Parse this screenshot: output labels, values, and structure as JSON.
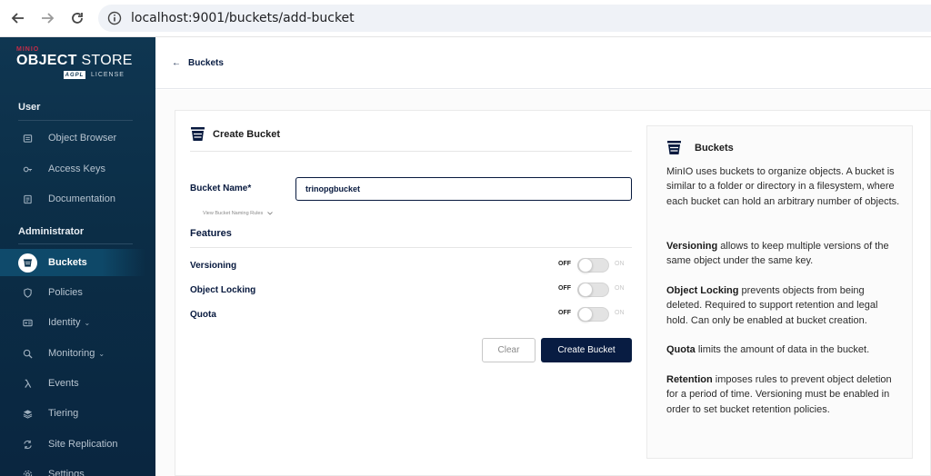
{
  "browser": {
    "url": "localhost:9001/buckets/add-bucket"
  },
  "logo": {
    "brand": "MINIO",
    "title_bold": "OBJECT",
    "title_rest": " STORE",
    "badge": "AGPL",
    "license": "LICENSE"
  },
  "sidebar": {
    "user_section": "User",
    "admin_section": "Administrator",
    "user_items": [
      {
        "label": "Object Browser",
        "icon": "folder-icon"
      },
      {
        "label": "Access Keys",
        "icon": "key-icon"
      },
      {
        "label": "Documentation",
        "icon": "document-icon"
      }
    ],
    "admin_items": [
      {
        "label": "Buckets",
        "icon": "bucket-icon",
        "active": true
      },
      {
        "label": "Policies",
        "icon": "shield-icon"
      },
      {
        "label": "Identity",
        "icon": "id-card-icon",
        "chevron": "⌄"
      },
      {
        "label": "Monitoring",
        "icon": "monitor-icon",
        "chevron": "⌄"
      },
      {
        "label": "Events",
        "icon": "lambda-icon"
      },
      {
        "label": "Tiering",
        "icon": "layers-icon"
      },
      {
        "label": "Site Replication",
        "icon": "sync-icon"
      },
      {
        "label": "Settings",
        "icon": "gear-icon"
      }
    ]
  },
  "header": {
    "back_label": "Buckets"
  },
  "form": {
    "title": "Create Bucket",
    "bucket_name_label": "Bucket Name*",
    "bucket_name_value": "trinopgbucket",
    "naming_rules": "View Bucket Naming Rules",
    "features_title": "Features",
    "toggles": [
      {
        "label": "Versioning",
        "off": "OFF",
        "on": "ON",
        "value": false
      },
      {
        "label": "Object Locking",
        "off": "OFF",
        "on": "ON",
        "value": false
      },
      {
        "label": "Quota",
        "off": "OFF",
        "on": "ON",
        "value": false
      }
    ],
    "clear_label": "Clear",
    "create_label": "Create Bucket"
  },
  "help": {
    "title": "Buckets",
    "intro": "MinIO uses buckets to organize objects. A bucket is similar to a folder or directory in a filesystem, where each bucket can hold an arbitrary number of objects.",
    "versioning_term": "Versioning",
    "versioning_text": " allows to keep multiple versions of the same object under the same key.",
    "locking_term": "Object Locking",
    "locking_text": " prevents objects from being deleted. Required to support retention and legal hold. Can only be enabled at bucket creation.",
    "quota_term": "Quota",
    "quota_text": " limits the amount of data in the bucket.",
    "retention_term": "Retention",
    "retention_text": " imposes rules to prevent object deletion for a period of time. Versioning must be enabled in order to set bucket retention policies."
  },
  "colors": {
    "sidebar_bg": "#0f3651",
    "primary": "#081c42",
    "brand_red": "#c72c48"
  }
}
